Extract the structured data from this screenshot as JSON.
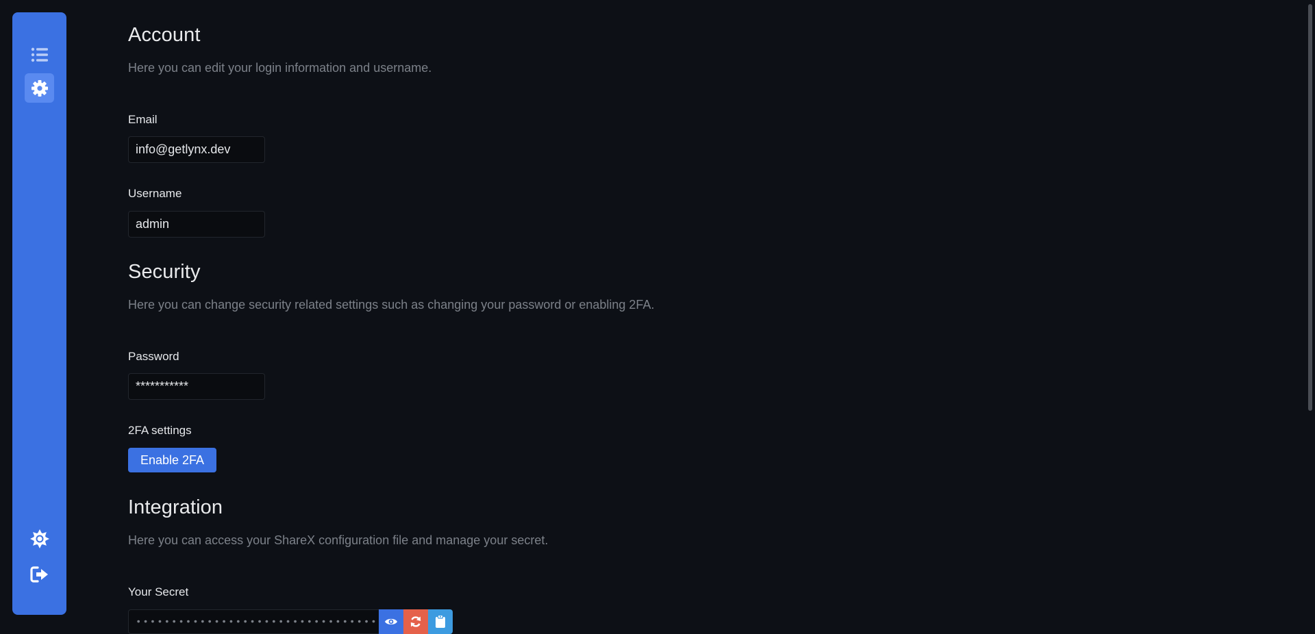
{
  "sidebar": {
    "items": [
      {
        "icon": "list-icon"
      },
      {
        "icon": "gear-icon",
        "active": true
      },
      {
        "icon": "sun-icon"
      },
      {
        "icon": "logout-icon"
      }
    ]
  },
  "account": {
    "title": "Account",
    "description": "Here you can edit your login information and username.",
    "email_label": "Email",
    "email_value": "info@getlynx.dev",
    "username_label": "Username",
    "username_value": "admin"
  },
  "security": {
    "title": "Security",
    "description": "Here you can change security related settings such as changing your password or enabling 2FA.",
    "password_label": "Password",
    "password_value": "***********",
    "twofa_label": "2FA settings",
    "twofa_button": "Enable 2FA"
  },
  "integration": {
    "title": "Integration",
    "description": "Here you can access your ShareX configuration file and manage your secret.",
    "secret_label": "Your Secret",
    "secret_value": "••••••••••••••••••••••••••••••••••••"
  },
  "colors": {
    "accent": "#3b71e2",
    "background": "#0d1016",
    "danger": "#e5614a",
    "info": "#3d9be0"
  }
}
